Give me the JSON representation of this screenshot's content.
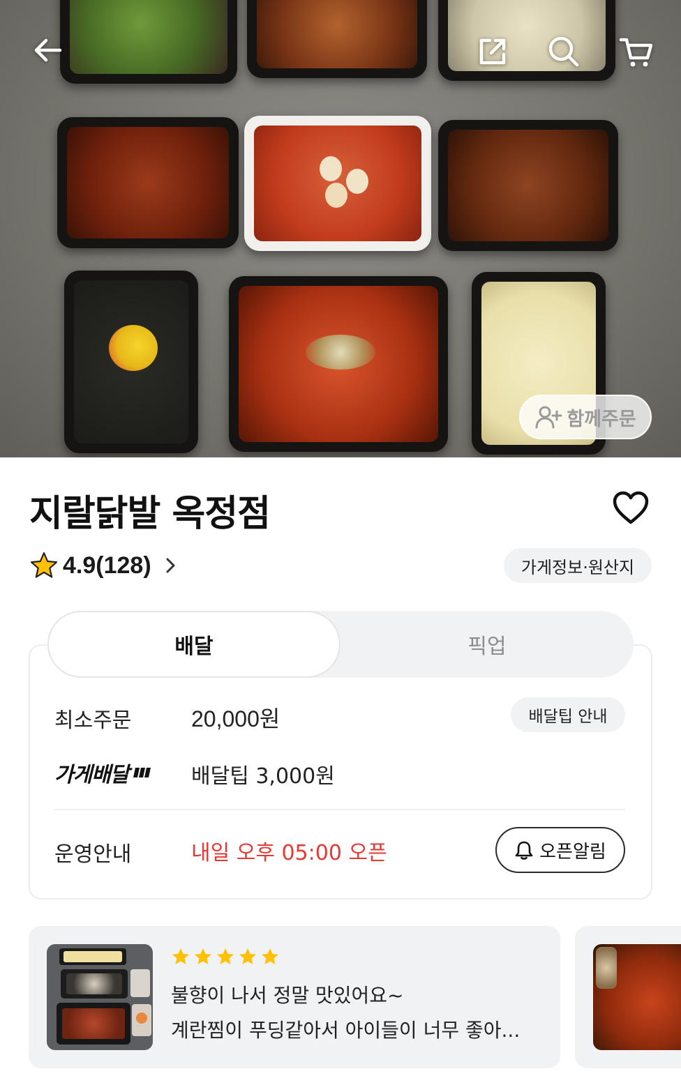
{
  "header": {
    "back_icon": "arrow-left-icon",
    "share_icon": "share-icon",
    "search_icon": "search-icon",
    "cart_icon": "cart-icon",
    "together_order_label": "함께주문"
  },
  "store": {
    "name": "지랄닭발 옥정점",
    "rating": "4.9(128)",
    "info_chip": "가게정보·원산지"
  },
  "order_tabs": [
    {
      "label": "배달",
      "selected": true
    },
    {
      "label": "픽업",
      "selected": false
    }
  ],
  "delivery": {
    "min_order_label": "최소주문",
    "min_order_value": "20,000원",
    "tip_info_label": "배달팁 안내",
    "store_delivery_label": "가게배달",
    "tip_value": "배달팁 3,000원",
    "hours_label": "운영안내",
    "open_time": "내일 오후 05:00 오픈",
    "open_alarm_label": "오픈알림"
  },
  "reviews": [
    {
      "stars": 5,
      "line1": "불향이 나서 정말 맛있어요~",
      "line2": "계란찜이 푸딩같아서 아이들이 너무 좋아..."
    }
  ],
  "colors": {
    "accent_red": "#e53935",
    "star_yellow": "#ffc107",
    "chip_bg": "#f1f2f4"
  }
}
